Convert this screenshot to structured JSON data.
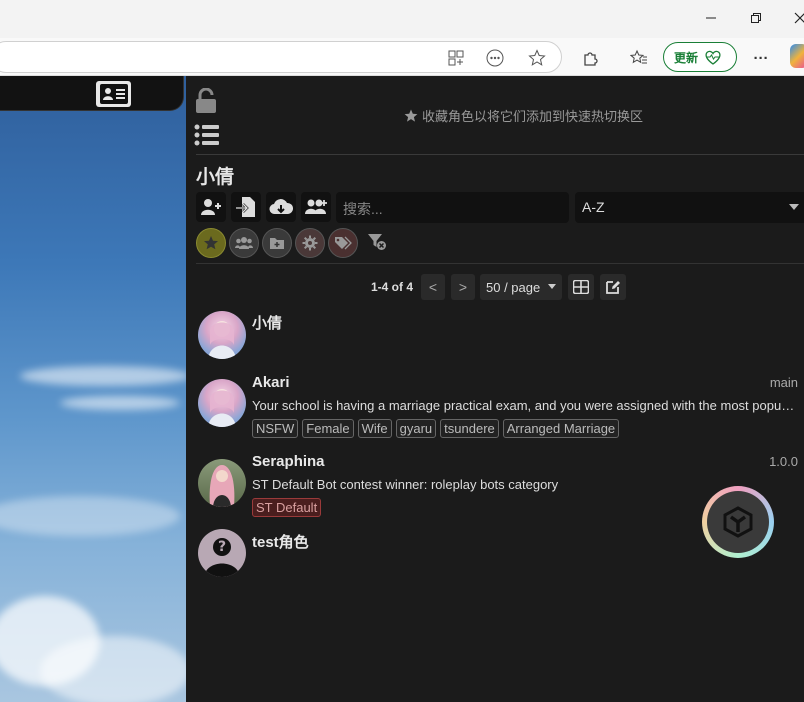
{
  "browser": {
    "update_label": "更新",
    "menu_label": "···"
  },
  "panel": {
    "hotswap_hint": "收藏角色以将它们添加到快速热切换区",
    "current_character": "小倩",
    "search_placeholder": "搜索...",
    "sort_value": "A-Z",
    "pager": {
      "count": "1-4 of 4",
      "prev": "<",
      "next": ">",
      "page_size": "50 / page"
    }
  },
  "characters": [
    {
      "name": "小倩",
      "version": "",
      "description": "",
      "tags": []
    },
    {
      "name": "Akari",
      "version": "main",
      "description": "Your school is having a marriage practical exam, and you were assigned with the most popular girl in your class",
      "tags": [
        "NSFW",
        "Female",
        "Wife",
        "gyaru",
        "tsundere",
        "Arranged Marriage"
      ]
    },
    {
      "name": "Seraphina",
      "version": "1.0.0",
      "description": "ST Default Bot contest winner: roleplay bots category",
      "tags": [
        "ST Default"
      ]
    },
    {
      "name": "test角色",
      "version": "",
      "description": "",
      "tags": []
    }
  ],
  "colors": {
    "panel_bg": "#1b1b1b",
    "update_green": "#1a7f37",
    "default_tag_red": "#9a3a3a"
  }
}
